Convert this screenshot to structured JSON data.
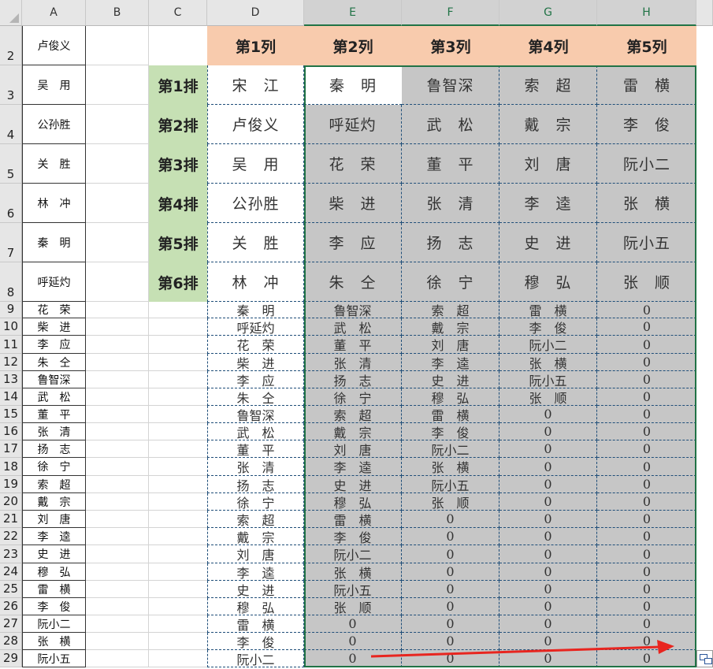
{
  "columns": [
    "A",
    "B",
    "C",
    "D",
    "E",
    "F",
    "G",
    "H"
  ],
  "rows": [
    "2",
    "3",
    "4",
    "5",
    "6",
    "7",
    "8",
    "9",
    "10",
    "11",
    "12",
    "13",
    "14",
    "15",
    "16",
    "17",
    "18",
    "19",
    "20",
    "21",
    "22",
    "23",
    "24",
    "25",
    "26",
    "27",
    "28",
    "29"
  ],
  "colA": [
    "卢俊义",
    "吴　用",
    "公孙胜",
    "关　胜",
    "林　冲",
    "秦　明",
    "呼延灼",
    "花　荣",
    "柴　进",
    "李　应",
    "朱　仝",
    "鲁智深",
    "武　松",
    "董　平",
    "张　清",
    "扬　志",
    "徐　宁",
    "索　超",
    "戴　宗",
    "刘　唐",
    "李　逵",
    "史　进",
    "穆　弘",
    "雷　横",
    "李　俊",
    "阮小二",
    "张　横",
    "阮小五"
  ],
  "header_labels": [
    "第1列",
    "第2列",
    "第3列",
    "第4列",
    "第5列"
  ],
  "pai_labels": [
    "第1排",
    "第2排",
    "第3排",
    "第4排",
    "第5排",
    "第6排"
  ],
  "grid": [
    [
      "宋　江",
      "秦　明",
      "鲁智深",
      "索　超",
      "雷　横"
    ],
    [
      "卢俊义",
      "呼延灼",
      "武　松",
      "戴　宗",
      "李　俊"
    ],
    [
      "吴　用",
      "花　荣",
      "董　平",
      "刘　唐",
      "阮小二"
    ],
    [
      "公孙胜",
      "柴　进",
      "张　清",
      "李　逵",
      "张　横"
    ],
    [
      "关　胜",
      "李　应",
      "扬　志",
      "史　进",
      "阮小五"
    ],
    [
      "林　冲",
      "朱　仝",
      "徐　宁",
      "穆　弘",
      "张　顺"
    ],
    [
      "秦　明",
      "鲁智深",
      "索　超",
      "雷　横",
      "0"
    ],
    [
      "呼延灼",
      "武　松",
      "戴　宗",
      "李　俊",
      "0"
    ],
    [
      "花　荣",
      "董　平",
      "刘　唐",
      "阮小二",
      "0"
    ],
    [
      "柴　进",
      "张　清",
      "李　逵",
      "张　横",
      "0"
    ],
    [
      "李　应",
      "扬　志",
      "史　进",
      "阮小五",
      "0"
    ],
    [
      "朱　仝",
      "徐　宁",
      "穆　弘",
      "张　顺",
      "0"
    ],
    [
      "鲁智深",
      "索　超",
      "雷　横",
      "0",
      "0"
    ],
    [
      "武　松",
      "戴　宗",
      "李　俊",
      "0",
      "0"
    ],
    [
      "董　平",
      "刘　唐",
      "阮小二",
      "0",
      "0"
    ],
    [
      "张　清",
      "李　逵",
      "张　横",
      "0",
      "0"
    ],
    [
      "扬　志",
      "史　进",
      "阮小五",
      "0",
      "0"
    ],
    [
      "徐　宁",
      "穆　弘",
      "张　顺",
      "0",
      "0"
    ],
    [
      "索　超",
      "雷　横",
      "0",
      "0",
      "0"
    ],
    [
      "戴　宗",
      "李　俊",
      "0",
      "0",
      "0"
    ],
    [
      "刘　唐",
      "阮小二",
      "0",
      "0",
      "0"
    ],
    [
      "李　逵",
      "张　横",
      "0",
      "0",
      "0"
    ],
    [
      "史　进",
      "阮小五",
      "0",
      "0",
      "0"
    ],
    [
      "穆　弘",
      "张　顺",
      "0",
      "0",
      "0"
    ],
    [
      "雷　横",
      "0",
      "0",
      "0",
      "0"
    ],
    [
      "李　俊",
      "0",
      "0",
      "0",
      "0"
    ],
    [
      "阮小二",
      "0",
      "0",
      "0",
      "0"
    ]
  ],
  "colors": {
    "header_fill": "#f8cbad",
    "pai_fill": "#c6e0b4",
    "selection_fill": "#c6c6c6",
    "selection_border": "#217346",
    "arrow": "#e8251f"
  }
}
